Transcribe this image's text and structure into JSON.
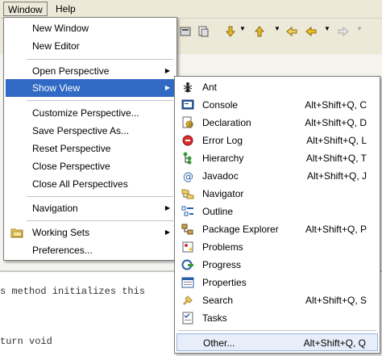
{
  "menubar": {
    "items": [
      {
        "label": "Window"
      },
      {
        "label": "Help"
      }
    ]
  },
  "editor": {
    "lines": [
      "s method initializes this",
      "turn void"
    ]
  },
  "window_menu": {
    "items": [
      {
        "label": "New Window"
      },
      {
        "label": "New Editor"
      },
      {
        "label": "Open Perspective"
      },
      {
        "label": "Show View"
      },
      {
        "label": "Customize Perspective..."
      },
      {
        "label": "Save Perspective As..."
      },
      {
        "label": "Reset Perspective"
      },
      {
        "label": "Close Perspective"
      },
      {
        "label": "Close All Perspectives"
      },
      {
        "label": "Navigation"
      },
      {
        "label": "Working Sets"
      },
      {
        "label": "Preferences..."
      }
    ]
  },
  "show_view_menu": {
    "items": [
      {
        "label": "Ant",
        "shortcut": "",
        "icon": "ant-icon"
      },
      {
        "label": "Console",
        "shortcut": "Alt+Shift+Q, C",
        "icon": "console-icon"
      },
      {
        "label": "Declaration",
        "shortcut": "Alt+Shift+Q, D",
        "icon": "declaration-icon"
      },
      {
        "label": "Error Log",
        "shortcut": "Alt+Shift+Q, L",
        "icon": "error-log-icon"
      },
      {
        "label": "Hierarchy",
        "shortcut": "Alt+Shift+Q, T",
        "icon": "hierarchy-icon"
      },
      {
        "label": "Javadoc",
        "shortcut": "Alt+Shift+Q, J",
        "icon": "javadoc-icon"
      },
      {
        "label": "Navigator",
        "shortcut": "",
        "icon": "navigator-icon"
      },
      {
        "label": "Outline",
        "shortcut": "",
        "icon": "outline-icon"
      },
      {
        "label": "Package Explorer",
        "shortcut": "Alt+Shift+Q, P",
        "icon": "package-explorer-icon"
      },
      {
        "label": "Problems",
        "shortcut": "",
        "icon": "problems-icon"
      },
      {
        "label": "Progress",
        "shortcut": "",
        "icon": "progress-icon"
      },
      {
        "label": "Properties",
        "shortcut": "",
        "icon": "properties-icon"
      },
      {
        "label": "Search",
        "shortcut": "Alt+Shift+Q, S",
        "icon": "search-icon"
      },
      {
        "label": "Tasks",
        "shortcut": "",
        "icon": "tasks-icon"
      },
      {
        "label": "Other...",
        "shortcut": "Alt+Shift+Q, Q",
        "icon": ""
      }
    ]
  },
  "colors": {
    "highlight": "#316ac5",
    "menubar_bg": "#ece9d8"
  }
}
